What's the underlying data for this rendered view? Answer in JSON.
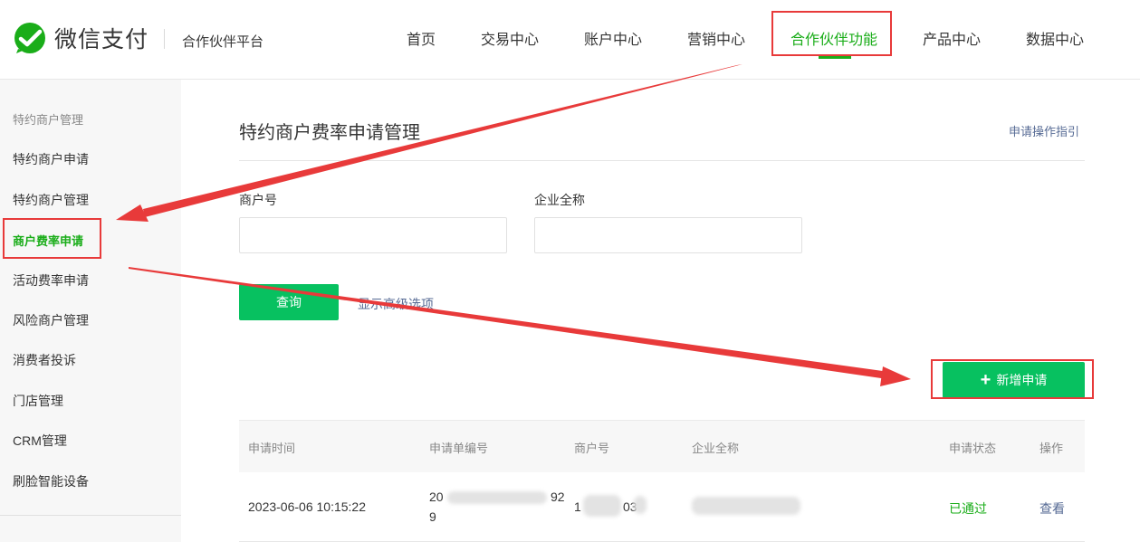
{
  "brand": {
    "name": "微信支付",
    "platform": "合作伙伴平台"
  },
  "nav": [
    {
      "label": "首页"
    },
    {
      "label": "交易中心"
    },
    {
      "label": "账户中心"
    },
    {
      "label": "营销中心"
    },
    {
      "label": "合作伙伴功能",
      "active": true
    },
    {
      "label": "产品中心"
    },
    {
      "label": "数据中心"
    }
  ],
  "sidebar": {
    "group": "特约商户管理",
    "items": [
      {
        "label": "特约商户申请"
      },
      {
        "label": "特约商户管理"
      },
      {
        "label": "商户费率申请",
        "active": true
      },
      {
        "label": "活动费率申请"
      },
      {
        "label": "风险商户管理"
      },
      {
        "label": "消费者投诉"
      },
      {
        "label": "门店管理"
      },
      {
        "label": "CRM管理"
      },
      {
        "label": "刷脸智能设备"
      }
    ]
  },
  "main": {
    "title": "特约商户费率申请管理",
    "guide_link": "申请操作指引",
    "filters": {
      "merchant_id_label": "商户号",
      "merchant_id_value": "",
      "company_label": "企业全称",
      "company_value": ""
    },
    "query_button": "查询",
    "advanced_link": "显示高级选项",
    "add_button": "新增申请",
    "table": {
      "headers": [
        "申请时间",
        "申请单编号",
        "商户号",
        "企业全称",
        "申请状态",
        "操作"
      ],
      "rows": [
        {
          "time": "2023-06-06 10:15:22",
          "order_no_a": "20",
          "order_no_b": "92",
          "order_no_c": "9",
          "merchant_a": "1",
          "merchant_b": "03",
          "company": "",
          "status": "已通过",
          "action": "查看"
        }
      ]
    }
  },
  "colors": {
    "brand_green": "#1aad19",
    "button_green": "#07c160",
    "link_blue": "#576b95",
    "annotation_red": "#e83a3a"
  }
}
